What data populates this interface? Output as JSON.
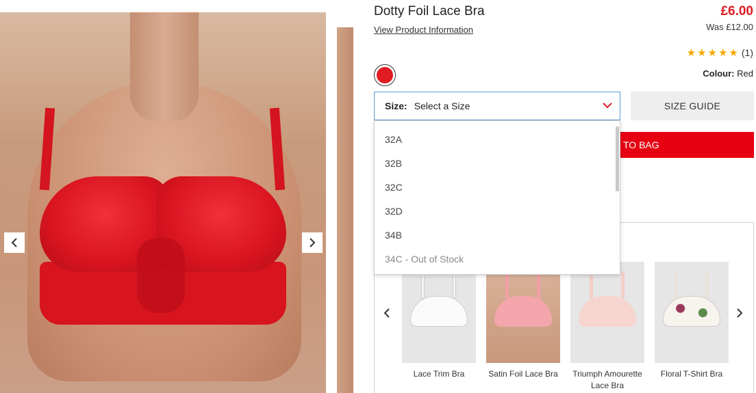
{
  "product": {
    "title": "Dotty Foil Lace Bra",
    "view_info_link": "View Product Information",
    "price": "£6.00",
    "was_price": "Was £12.00",
    "rating_count": "(1)",
    "rating_stars": 5,
    "colour_label": "Colour:",
    "colour_value": "Red",
    "swatch_color": "#e01b22"
  },
  "size_select": {
    "label": "Size:",
    "placeholder": "Select a Size",
    "options": [
      "32A",
      "32B",
      "32C",
      "32D",
      "34B",
      "34C - Out of Stock"
    ]
  },
  "size_guide_label": "SIZE GUIDE",
  "add_to_bag_label": "TO BAG",
  "recommendations": [
    {
      "name": "Lace Trim Bra"
    },
    {
      "name": "Satin Foil Lace Bra"
    },
    {
      "name": "Triumph Amourette Lace Bra"
    },
    {
      "name": "Floral T-Shirt Bra"
    }
  ],
  "colors": {
    "accent_red": "#e60012",
    "price_red": "#e01b22",
    "star": "#f7a700"
  }
}
